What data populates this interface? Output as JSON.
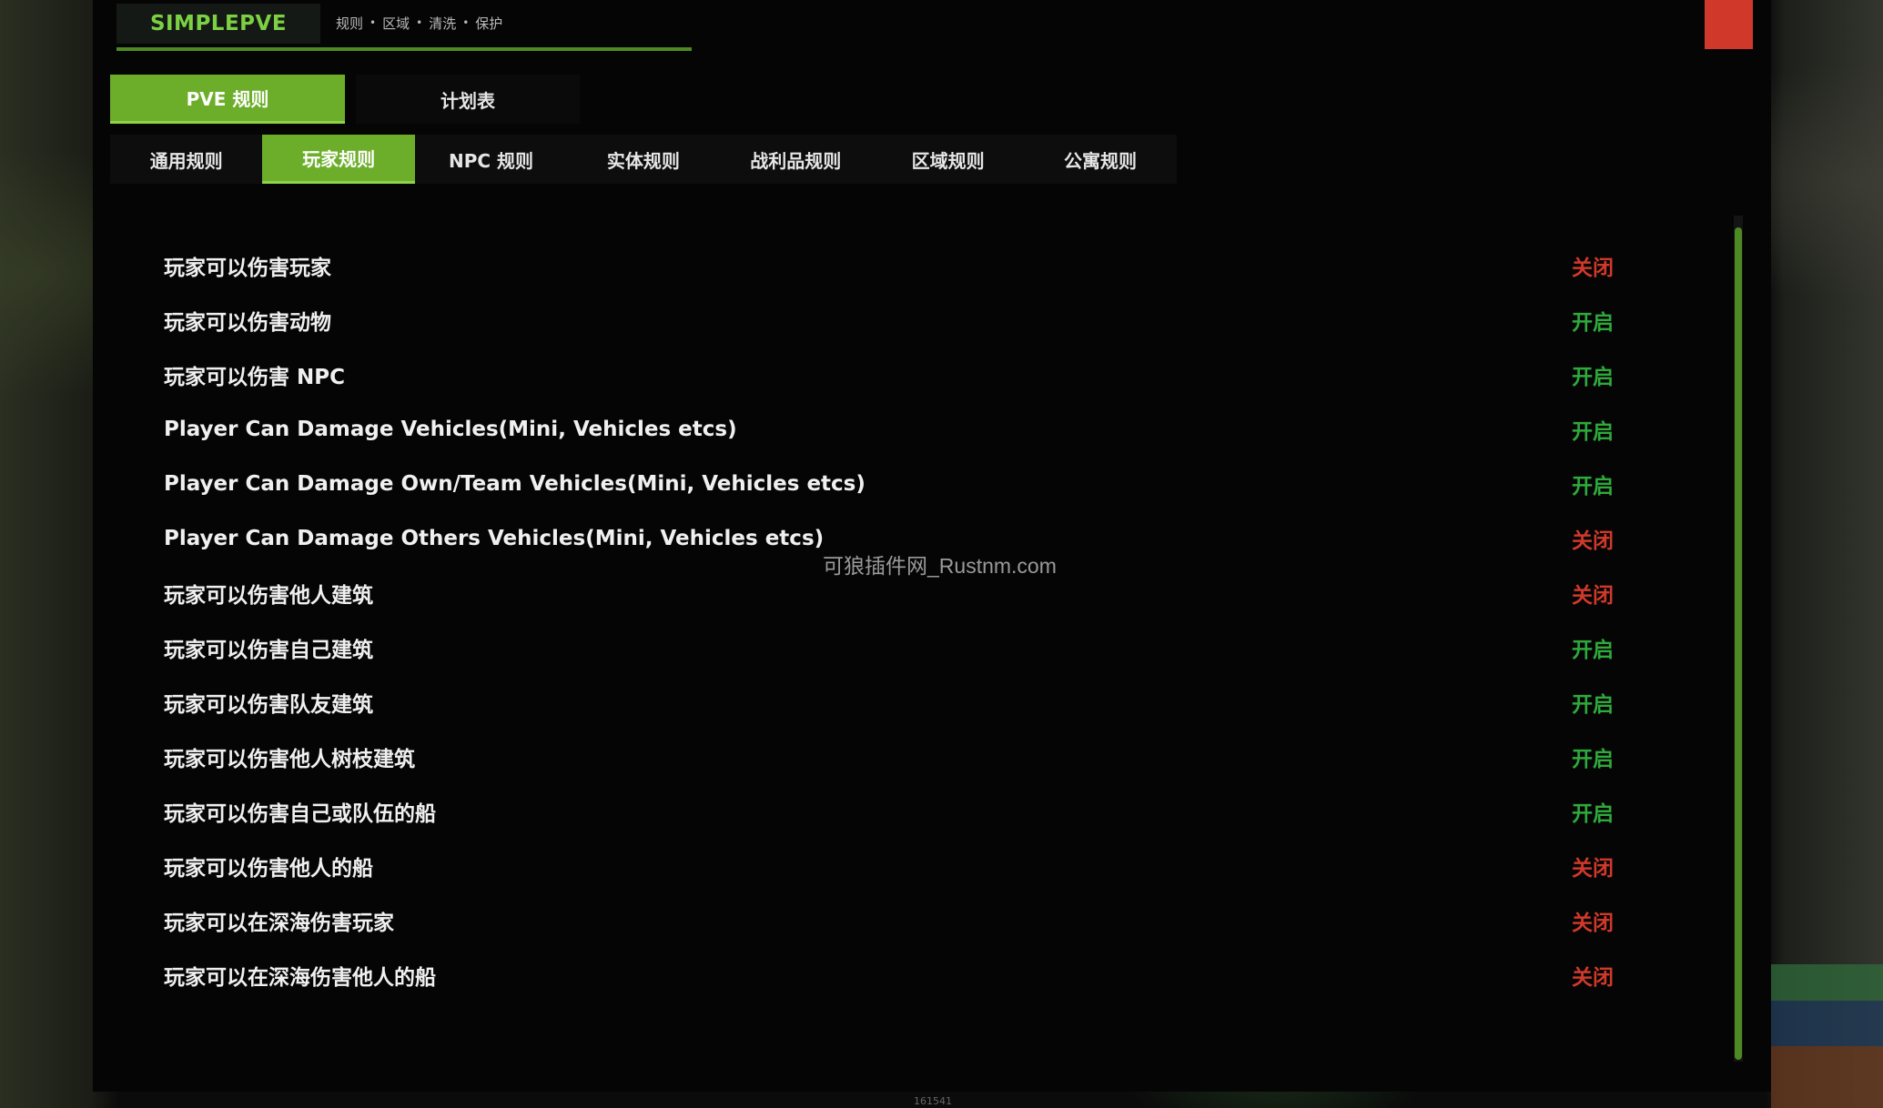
{
  "app": {
    "logo": "SIMPLEPVE",
    "breadcrumb": [
      "规则",
      "区域",
      "清洗",
      "保护"
    ]
  },
  "top_tabs": [
    {
      "label": "PVE 规则",
      "active": true
    },
    {
      "label": "计划表",
      "active": false
    }
  ],
  "sub_tabs": [
    {
      "label": "通用规则",
      "active": false
    },
    {
      "label": "玩家规则",
      "active": true
    },
    {
      "label": "NPC 规则",
      "active": false
    },
    {
      "label": "实体规则",
      "active": false
    },
    {
      "label": "战利品规则",
      "active": false
    },
    {
      "label": "区域规则",
      "active": false
    },
    {
      "label": "公寓规则",
      "active": false
    }
  ],
  "rules": [
    {
      "label": "玩家可以伤害玩家",
      "status": "关闭",
      "enabled": false
    },
    {
      "label": "玩家可以伤害动物",
      "status": "开启",
      "enabled": true
    },
    {
      "label": "玩家可以伤害 NPC",
      "status": "开启",
      "enabled": true
    },
    {
      "label": "Player Can Damage Vehicles(Mini, Vehicles etcs)",
      "status": "开启",
      "enabled": true
    },
    {
      "label": "Player Can Damage Own/Team Vehicles(Mini, Vehicles etcs)",
      "status": "开启",
      "enabled": true
    },
    {
      "label": "Player Can Damage Others Vehicles(Mini, Vehicles etcs)",
      "status": "关闭",
      "enabled": false
    },
    {
      "label": "玩家可以伤害他人建筑",
      "status": "关闭",
      "enabled": false
    },
    {
      "label": "玩家可以伤害自己建筑",
      "status": "开启",
      "enabled": true
    },
    {
      "label": "玩家可以伤害队友建筑",
      "status": "开启",
      "enabled": true
    },
    {
      "label": "玩家可以伤害他人树枝建筑",
      "status": "开启",
      "enabled": true
    },
    {
      "label": "玩家可以伤害自己或队伍的船",
      "status": "开启",
      "enabled": true
    },
    {
      "label": "玩家可以伤害他人的船",
      "status": "关闭",
      "enabled": false
    },
    {
      "label": "玩家可以在深海伤害玩家",
      "status": "关闭",
      "enabled": false
    },
    {
      "label": "玩家可以在深海伤害他人的船",
      "status": "关闭",
      "enabled": false
    }
  ],
  "watermark": "可狼插件网_Rustnm.com",
  "footer_code": "161541",
  "colors": {
    "accent": "#6cae2a",
    "on": "#2fa93b",
    "off": "#d0392a",
    "close_button": "#d0392a"
  }
}
